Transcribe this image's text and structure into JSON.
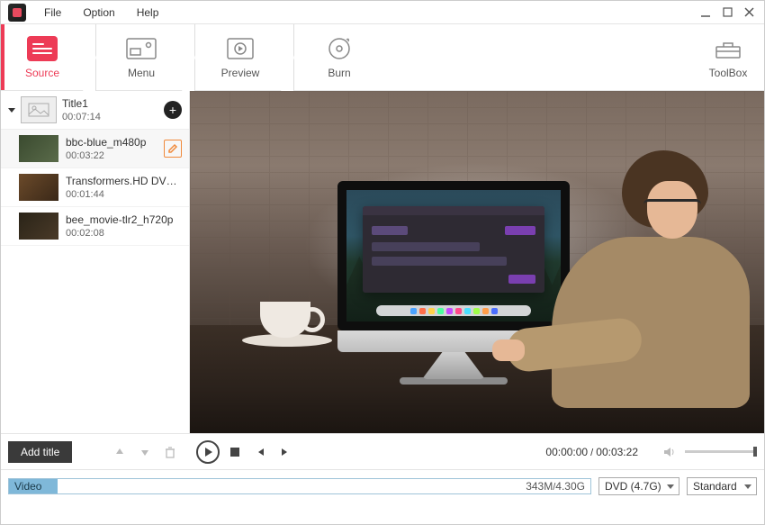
{
  "menu": {
    "file": "File",
    "option": "Option",
    "help": "Help"
  },
  "tabs": {
    "source": "Source",
    "menu": "Menu",
    "preview": "Preview",
    "burn": "Burn",
    "toolbox": "ToolBox"
  },
  "title_group": {
    "name": "Title1",
    "duration": "00:07:14"
  },
  "clips": [
    {
      "name": "bbc-blue_m480p",
      "duration": "00:03:22"
    },
    {
      "name": "Transformers.HD DVD...",
      "duration": "00:01:44"
    },
    {
      "name": "bee_movie-tlr2_h720p",
      "duration": "00:02:08"
    }
  ],
  "controls": {
    "add_title": "Add title"
  },
  "playback": {
    "current": "00:00:00",
    "total": "00:03:22"
  },
  "storage": {
    "label": "Video",
    "used": "343M",
    "total": "4.30G"
  },
  "output": {
    "disc": "DVD (4.7G)",
    "quality": "Standard"
  }
}
